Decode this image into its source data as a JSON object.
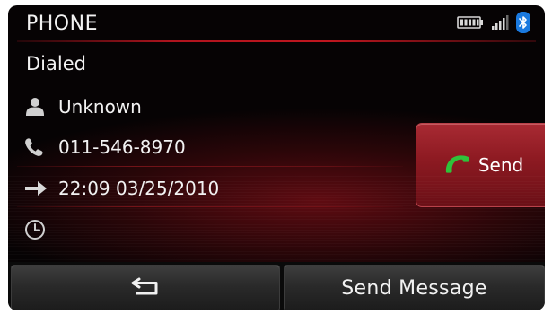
{
  "header": {
    "title": "PHONE",
    "icons": [
      "battery-icon",
      "signal-icon",
      "bluetooth-icon"
    ]
  },
  "status": "Dialed",
  "call_details": {
    "contact": {
      "icon": "person-icon",
      "value": "Unknown"
    },
    "number": {
      "icon": "phone-handset-icon",
      "value": "011-546-8970"
    },
    "time": {
      "icon": "outgoing-arrow-icon",
      "value": "22:09 03/25/2010"
    },
    "duration": {
      "icon": "clock-icon",
      "value": ""
    }
  },
  "actions": {
    "send_label": "Send",
    "send_icon": "green-handset-icon",
    "back_icon": "back-arrow-icon",
    "send_message_label": "Send Message"
  },
  "colors": {
    "accent_red": "#b0141e",
    "call_green": "#2fc23a",
    "bluetooth_blue": "#1a7ae0"
  }
}
